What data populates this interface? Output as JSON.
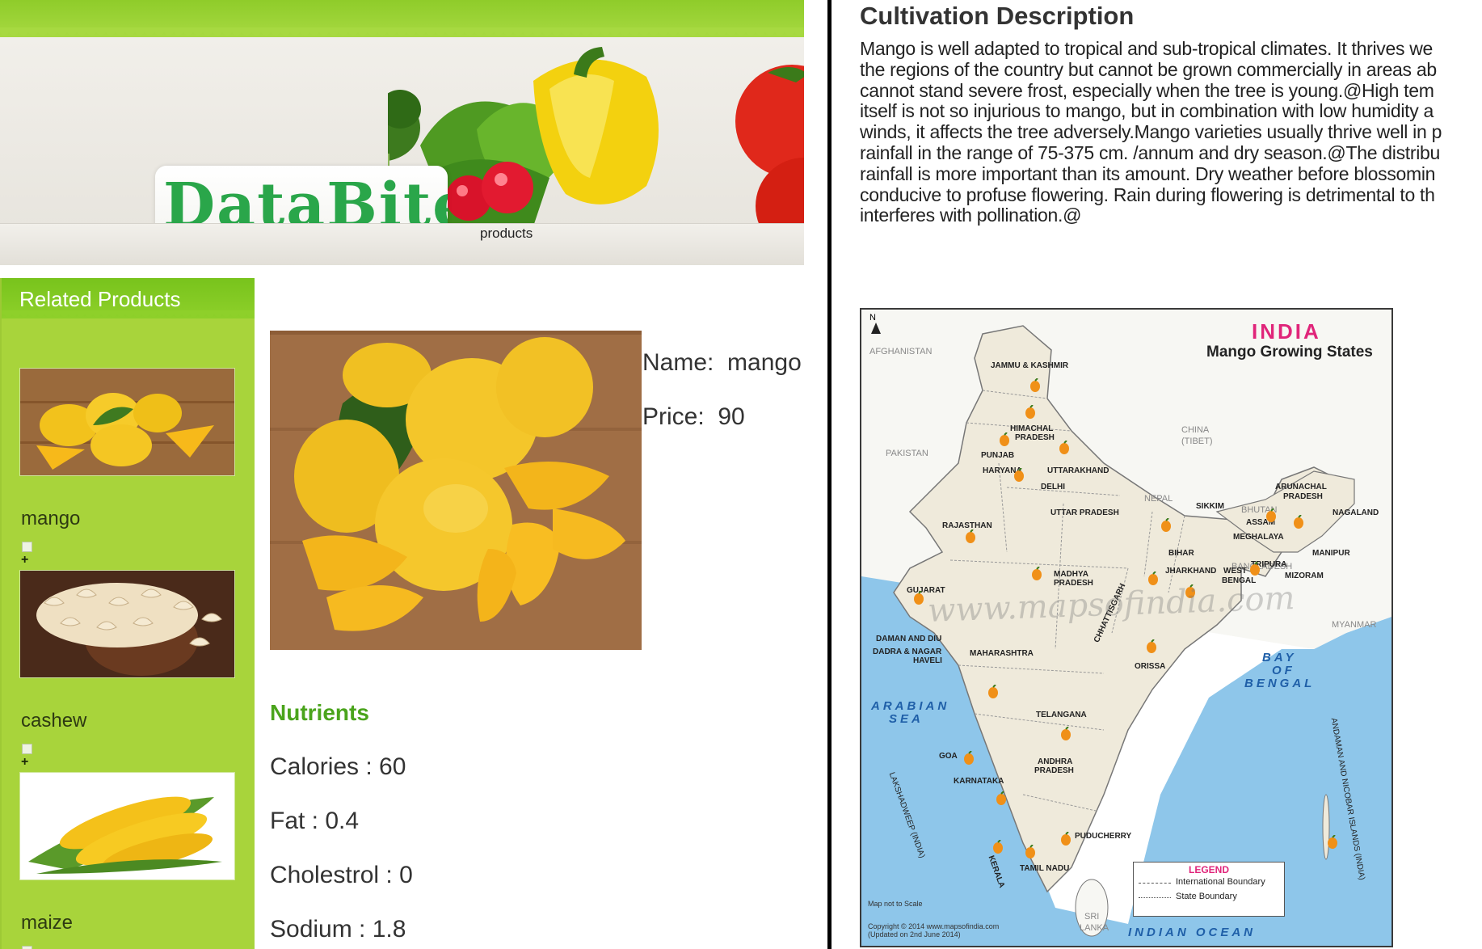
{
  "header": {
    "logo_text": "DataBite",
    "nav_products": "products"
  },
  "sidebar": {
    "title": "Related Products",
    "items": [
      {
        "label": "mango",
        "plus": "+"
      },
      {
        "label": "cashew",
        "plus": "+"
      },
      {
        "label": "maize"
      }
    ]
  },
  "product": {
    "name_field": "Name:  mango",
    "price_field": "Price:  90"
  },
  "nutrients": {
    "title": "Nutrients",
    "items": [
      "Calories : 60",
      "Fat : 0.4",
      "Cholestrol : 0",
      "Sodium : 1.8"
    ]
  },
  "cultivation": {
    "title": "Cultivation Description",
    "text": "Mango is well adapted to tropical and sub-tropical climates. It thrives we\nthe regions of the country but cannot be grown commercially in areas ab\ncannot stand severe frost, especially when the tree is young.@High tem\nitself is not so injurious to mango, but in combination with low humidity a\nwinds, it affects the tree adversely.Mango varieties usually thrive well in p\nrainfall in the range of 75-375 cm. /annum and dry season.@The distribu\nrainfall is more important than its amount. Dry weather before blossomin\nconducive to profuse flowering. Rain during flowering is detrimental to th\ninterferes with pollination.@"
  },
  "map": {
    "title": "INDIA",
    "subtitle": "Mango Growing States",
    "north": "N",
    "countries": [
      "AFGHANISTAN",
      "PAKISTAN",
      "CHINA",
      "(TIBET)",
      "NEPAL",
      "BHUTAN",
      "BANGLADESH",
      "MYANMAR",
      "SRI",
      "LANKA"
    ],
    "states": [
      "JAMMU & KASHMIR",
      "HIMACHAL",
      "PRADESH",
      "PUNJAB",
      "HARYANA",
      "UTTARAKHAND",
      "DELHI",
      "RAJASTHAN",
      "UTTAR  PRADESH",
      "SIKKIM",
      "ARUNACHAL",
      "PRADESH",
      "ASSAM",
      "NAGALAND",
      "MEGHALAYA",
      "BIHAR",
      "MANIPUR",
      "TRIPURA",
      "JHARKHAND",
      "WEST",
      "BENGAL",
      "MIZORAM",
      "MADHYA",
      "PRADESH",
      "GUJARAT",
      "DAMAN AND DIU",
      "DADRA & NAGAR",
      "HAVELI",
      "MAHARASHTRA",
      "CHHATTISGARH",
      "ORISSA",
      "TELANGANA",
      "GOA",
      "ANDHRA",
      "PRADESH",
      "KARNATAKA",
      "PUDUCHERRY",
      "TAMIL NADU",
      "KERALA",
      "LAKSHADWEEP (INDIA)",
      "ANDAMAN AND NICOBAR ISLANDS (INDIA)"
    ],
    "seas": [
      "ARABIAN",
      "SEA",
      "BAY",
      "OF",
      "BENGAL",
      "INDIAN  OCEAN"
    ],
    "legend_title": "LEGEND",
    "legend_items": [
      "International Boundary",
      "State Boundary"
    ],
    "watermark": "www.mapsofindia.com",
    "scale_note": "Map not to Scale",
    "copyright": "Copyright © 2014 www.mapsofindia.com",
    "updated": "(Updated on 2nd June 2014)"
  }
}
